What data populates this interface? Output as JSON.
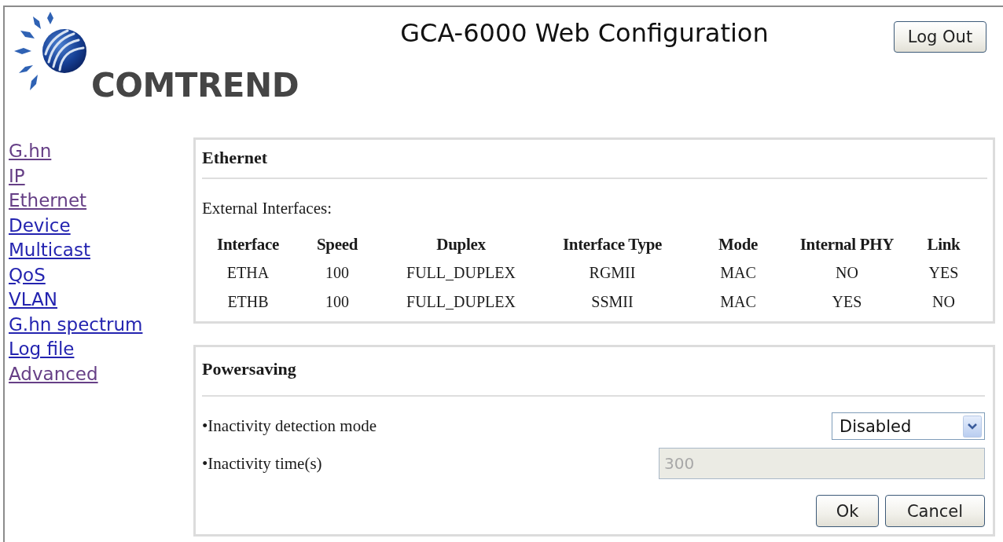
{
  "header": {
    "logo_text": "COMTREND",
    "title": "GCA-6000 Web Configuration",
    "logout_button": "Log Out"
  },
  "sidebar": {
    "items": [
      {
        "label": "G.hn",
        "visited": true
      },
      {
        "label": "IP",
        "visited": true
      },
      {
        "label": "Ethernet",
        "visited": true
      },
      {
        "label": "Device",
        "visited": false
      },
      {
        "label": "Multicast",
        "visited": false
      },
      {
        "label": "QoS",
        "visited": false
      },
      {
        "label": "VLAN",
        "visited": false
      },
      {
        "label": "G.hn spectrum",
        "visited": false
      },
      {
        "label": "Log file",
        "visited": false
      },
      {
        "label": "Advanced",
        "visited": true
      }
    ]
  },
  "ethernet": {
    "title": "Ethernet",
    "subtitle": "External Interfaces:",
    "table": {
      "columns": [
        "Interface",
        "Speed",
        "Duplex",
        "Interface Type",
        "Mode",
        "Internal PHY",
        "Link"
      ],
      "rows": [
        [
          "ETHA",
          "100",
          "FULL_DUPLEX",
          "RGMII",
          "MAC",
          "NO",
          "YES"
        ],
        [
          "ETHB",
          "100",
          "FULL_DUPLEX",
          "SSMII",
          "MAC",
          "YES",
          "NO"
        ]
      ]
    }
  },
  "powersaving": {
    "title": "Powersaving",
    "fields": [
      {
        "kind": "select",
        "label": "•Inactivity detection mode",
        "value": "Disabled",
        "disabled": false
      },
      {
        "kind": "text",
        "label": "•Inactivity time(s)",
        "value": "300",
        "disabled": true
      }
    ],
    "buttons": [
      "Ok",
      "Cancel"
    ]
  }
}
